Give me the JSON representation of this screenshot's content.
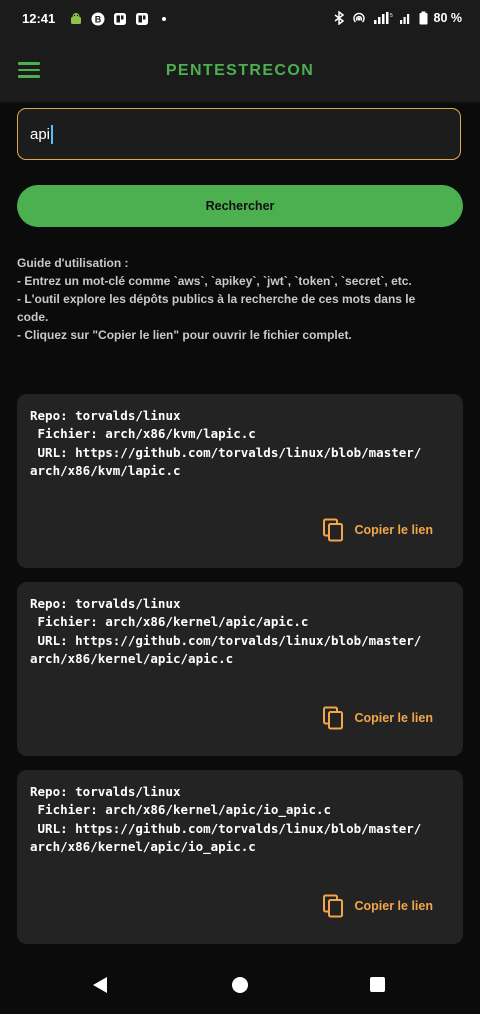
{
  "status": {
    "time": "12:41",
    "battery": "80 %"
  },
  "app": {
    "title": "PENTESTRECON"
  },
  "search": {
    "value": "api"
  },
  "button": {
    "label": "Rechercher"
  },
  "guide": {
    "title": "Guide d'utilisation :",
    "lines": [
      "- Entrez un mot-clé comme `aws`, `apikey`, `jwt`, `token`, `secret`, etc.",
      "- L'outil explore les dépôts publics à la recherche de ces mots dans le code.",
      "- Cliquez sur \"Copier le lien\" pour ouvrir le fichier complet."
    ]
  },
  "results": [
    {
      "repo_line": "Repo: torvalds/linux",
      "file_line": " Fichier: arch/x86/kvm/lapic.c",
      "url_line1": " URL: https://github.com/torvalds/linux/blob/master/",
      "url_line2": "arch/x86/kvm/lapic.c",
      "copy_label": "Copier le lien"
    },
    {
      "repo_line": "Repo: torvalds/linux",
      "file_line": " Fichier: arch/x86/kernel/apic/apic.c",
      "url_line1": " URL: https://github.com/torvalds/linux/blob/master/",
      "url_line2": "arch/x86/kernel/apic/apic.c",
      "copy_label": "Copier le lien"
    },
    {
      "repo_line": "Repo: torvalds/linux",
      "file_line": " Fichier: arch/x86/kernel/apic/io_apic.c",
      "url_line1": " URL: https://github.com/torvalds/linux/blob/master/",
      "url_line2": "arch/x86/kernel/apic/io_apic.c",
      "copy_label": "Copier le lien"
    }
  ],
  "colors": {
    "accent": "#4caf50",
    "input_border": "#e0a84e",
    "copy": "#f3a64a",
    "card_bg": "#232323",
    "background": "#0b0b0b"
  },
  "icons": {
    "menu": "hamburger-menu-icon",
    "copy": "content-copy-icon",
    "nav_back": "triangle-back-icon",
    "nav_home": "circle-home-icon",
    "nav_recents": "square-recents-icon"
  }
}
